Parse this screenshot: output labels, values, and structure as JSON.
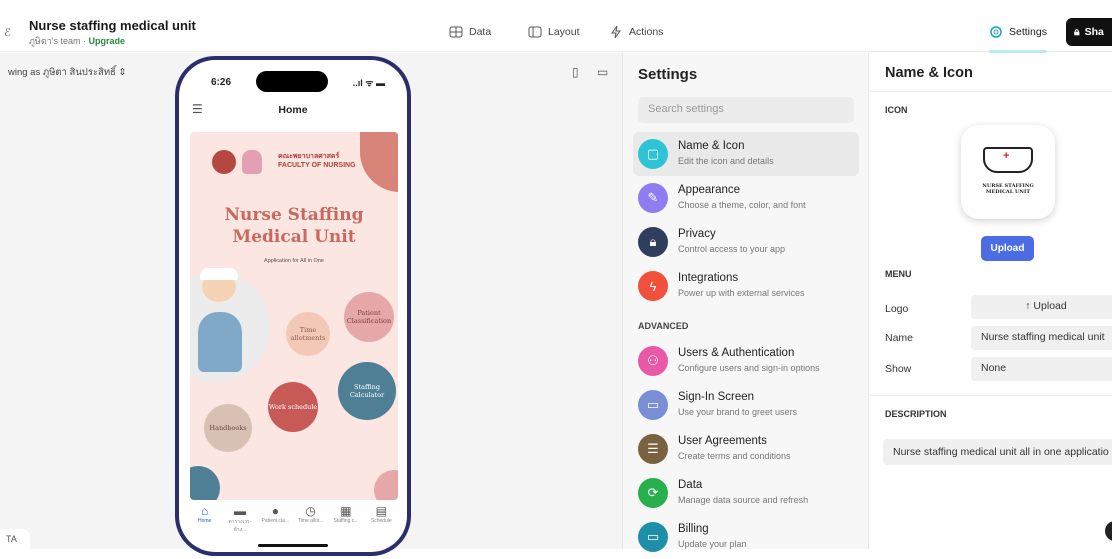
{
  "header": {
    "app_title": "Nurse staffing medical unit",
    "team": "ภูษิตา's team ·",
    "upgrade": "Upgrade",
    "nav": [
      {
        "label": "Data"
      },
      {
        "label": "Layout"
      },
      {
        "label": "Actions"
      }
    ],
    "settings_label": "Settings",
    "share_label": "Sha"
  },
  "canvas": {
    "viewing_as": "wing as ภูษิตา สินประสิทธิ์",
    "corner_badge": "TA"
  },
  "phone": {
    "time": "6:26",
    "status": "..ıl ᯤ ▬",
    "screen_title": "Home",
    "poster": {
      "faculty": "คณะพยาบาลศาสตร์\nFACULTY OF NURSING",
      "title_line1": "Nurse Staffing",
      "title_line2": "Medical Unit",
      "subtitle": "Application for All in One",
      "bubbles": [
        "Time allotments",
        "Patient Classification",
        "Staffing Calculator",
        "Work schedule",
        "Handbooks"
      ]
    },
    "tabs": [
      {
        "label": "Home",
        "active": true
      },
      {
        "label": "ตารางเวร-ห้าง..."
      },
      {
        "label": "Patient cla..."
      },
      {
        "label": "Time allot..."
      },
      {
        "label": "Staffing c..."
      },
      {
        "label": "Schedule"
      }
    ]
  },
  "settings": {
    "title": "Settings",
    "search_placeholder": "Search settings",
    "advanced_label": "ADVANCED",
    "items": [
      {
        "label": "Name & Icon",
        "desc": "Edit the icon and details",
        "color": "#2ec4d6"
      },
      {
        "label": "Appearance",
        "desc": "Choose a theme, color, and font",
        "color": "#8e7cf0"
      },
      {
        "label": "Privacy",
        "desc": "Control access to your app",
        "color": "#2f3e5c"
      },
      {
        "label": "Integrations",
        "desc": "Power up with external services",
        "color": "#f0503c"
      },
      {
        "label": "Users & Authentication",
        "desc": "Configure users and sign-in options",
        "color": "#e85aa8"
      },
      {
        "label": "Sign-In Screen",
        "desc": "Use your brand to greet users",
        "color": "#7a8ed6"
      },
      {
        "label": "User Agreements",
        "desc": "Create terms and conditions",
        "color": "#7a6240"
      },
      {
        "label": "Data",
        "desc": "Manage data source and refresh",
        "color": "#27b04b"
      },
      {
        "label": "Billing",
        "desc": "Update your plan",
        "color": "#1d8fa8"
      }
    ]
  },
  "detail": {
    "title": "Name & Icon",
    "icon_label": "ICON",
    "icon_text": "NURSE STAFFING\nMEDICAL UNIT",
    "upload_label": "Upload",
    "menu_label": "MENU",
    "logo_label": "Logo",
    "logo_upload": "↑ Upload",
    "name_label": "Name",
    "name_value": "Nurse staffing medical unit",
    "show_label": "Show",
    "show_value": "None",
    "description_label": "DESCRIPTION",
    "description_value": "Nurse staffing medical unit all in one applicatio"
  }
}
